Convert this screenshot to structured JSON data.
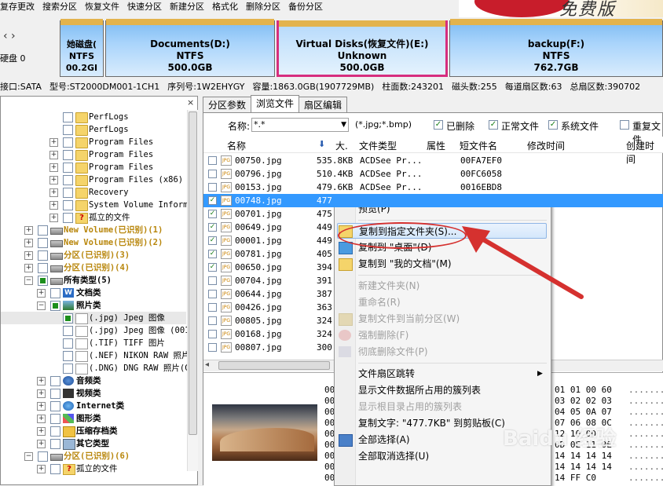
{
  "menubar": {
    "items": [
      "复存更改",
      "搜索分区",
      "恢复文件",
      "快速分区",
      "新建分区",
      "格式化",
      "删除分区",
      "备份分区"
    ]
  },
  "disk": {
    "label": "硬盘 0",
    "partitions": [
      {
        "name": "她磁盘(",
        "fs": "NTFS",
        "size": "00.2GI"
      },
      {
        "name": "Documents(D:)",
        "fs": "NTFS",
        "size": "500.0GB"
      },
      {
        "name": "Virtual Disks(恢复文件)(E:)",
        "fs": "Unknown",
        "size": "500.0GB"
      },
      {
        "name": "backup(F:)",
        "fs": "NTFS",
        "size": "762.7GB"
      }
    ]
  },
  "info_bar": [
    "接口:SATA",
    "型号:ST2000DM001-1CH1",
    "序列号:1W2EHYGY",
    "容量:1863.0GB(1907729MB)",
    "柱面数:243201",
    "磁头数:255",
    "每道扇区数:63",
    "总扇区数:390702"
  ],
  "tree": {
    "close": "×",
    "rows": [
      {
        "label": "PerfLogs",
        "indent": 4,
        "type": "folder",
        "expand": ""
      },
      {
        "label": "PerfLogs",
        "indent": 4,
        "type": "folder",
        "expand": ""
      },
      {
        "label": "Program Files",
        "indent": 4,
        "type": "folder",
        "expand": "+"
      },
      {
        "label": "Program Files",
        "indent": 4,
        "type": "folder",
        "expand": "+"
      },
      {
        "label": "Program Files",
        "indent": 4,
        "type": "folder",
        "expand": "+"
      },
      {
        "label": "Program Files (x86)",
        "indent": 4,
        "type": "folder",
        "expand": "+"
      },
      {
        "label": "Recovery",
        "indent": 4,
        "type": "folder",
        "expand": "+"
      },
      {
        "label": "System Volume Information",
        "indent": 4,
        "type": "folder",
        "expand": "+"
      },
      {
        "label": "孤立的文件",
        "indent": 4,
        "type": "q",
        "expand": "+"
      },
      {
        "label": "New Volume(已识别)(1)",
        "indent": 2,
        "type": "drive",
        "expand": "+",
        "style": "vol"
      },
      {
        "label": "New Volume(已识别)(2)",
        "indent": 2,
        "type": "drive",
        "expand": "+",
        "style": "vol"
      },
      {
        "label": "分区(已识别)(3)",
        "indent": 2,
        "type": "drive",
        "expand": "+",
        "style": "vol"
      },
      {
        "label": "分区(已识别)(4)",
        "indent": 2,
        "type": "drive",
        "expand": "+",
        "style": "vol"
      },
      {
        "label": "所有类型(5)",
        "indent": 2,
        "type": "drive",
        "expand": "−",
        "style": "bold",
        "partial": true
      },
      {
        "label": "文档类",
        "indent": 3,
        "type": "doc",
        "expand": "+",
        "style": "bold"
      },
      {
        "label": "照片类",
        "indent": 3,
        "type": "photo",
        "expand": "−",
        "style": "bold",
        "partial": true
      },
      {
        "label": "(.jpg) Jpeg 图像",
        "indent": 4,
        "type": "jpgi",
        "expand": "",
        "partial": true,
        "selected": true
      },
      {
        "label": "(.jpg) Jpeg 图像 (001)",
        "indent": 4,
        "type": "jpgi",
        "expand": ""
      },
      {
        "label": "(.TIF) TIFF 图片",
        "indent": 4,
        "type": "jpgi",
        "expand": ""
      },
      {
        "label": "(.NEF) NIKON RAW 照片",
        "indent": 4,
        "type": "jpgi",
        "expand": ""
      },
      {
        "label": "(.DNG) DNG RAW 照片(Ca",
        "indent": 4,
        "type": "jpgi",
        "expand": ""
      },
      {
        "label": "音频类",
        "indent": 3,
        "type": "music",
        "expand": "+",
        "style": "bold"
      },
      {
        "label": "视频类",
        "indent": 3,
        "type": "video",
        "expand": "+",
        "style": "bold"
      },
      {
        "label": "Internet类",
        "indent": 3,
        "type": "ie",
        "expand": "+",
        "style": "bold"
      },
      {
        "label": "图形类",
        "indent": 3,
        "type": "graph",
        "expand": "+",
        "style": "bold"
      },
      {
        "label": "压缩存档类",
        "indent": 3,
        "type": "zip",
        "expand": "+",
        "style": "bold"
      },
      {
        "label": "其它类型",
        "indent": 3,
        "type": "other",
        "expand": "+",
        "style": "bold"
      },
      {
        "label": "分区(已识别)(6)",
        "indent": 2,
        "type": "drive",
        "expand": "−",
        "style": "vol2"
      },
      {
        "label": "孤立的文件",
        "indent": 3,
        "type": "q",
        "expand": "+"
      }
    ]
  },
  "tabs": [
    "分区参数",
    "浏览文件",
    "扇区编辑"
  ],
  "filter": {
    "name_label": "名称:",
    "name_value": "*.*",
    "hint": "(*.jpg;*.bmp)",
    "checks": [
      {
        "label": "已删除",
        "checked": true
      },
      {
        "label": "正常文件",
        "checked": true
      },
      {
        "label": "系统文件",
        "checked": true
      },
      {
        "label": "重复文件",
        "checked": false
      }
    ]
  },
  "columns": [
    "名称",
    "大.",
    "文件类型",
    "属性",
    "短文件名",
    "修改时间",
    "创建时间"
  ],
  "files": [
    {
      "name": "00750.jpg",
      "size": "535.8KB",
      "type": "ACDSee Pr...",
      "short": "00FA7EF0",
      "checked": false
    },
    {
      "name": "00796.jpg",
      "size": "510.4KB",
      "type": "ACDSee Pr...",
      "short": "00FC6058",
      "checked": false
    },
    {
      "name": "00153.jpg",
      "size": "479.6KB",
      "type": "ACDSee Pr...",
      "short": "0016EBD8",
      "checked": false
    },
    {
      "name": "00748.jpg",
      "size": "477",
      "type": "",
      "short": "",
      "checked": true,
      "selected": true
    },
    {
      "name": "00701.jpg",
      "size": "475",
      "type": "",
      "short": "",
      "checked": true
    },
    {
      "name": "00649.jpg",
      "size": "449",
      "type": "",
      "short": "",
      "checked": true
    },
    {
      "name": "00001.jpg",
      "size": "449",
      "type": "",
      "short": "",
      "checked": true
    },
    {
      "name": "00781.jpg",
      "size": "405",
      "type": "",
      "short": "",
      "checked": true
    },
    {
      "name": "00650.jpg",
      "size": "394",
      "type": "",
      "short": "",
      "checked": true
    },
    {
      "name": "00704.jpg",
      "size": "391",
      "type": "",
      "short": "",
      "checked": false
    },
    {
      "name": "00644.jpg",
      "size": "387",
      "type": "",
      "short": "",
      "checked": false
    },
    {
      "name": "00426.jpg",
      "size": "363",
      "type": "",
      "short": "",
      "checked": false
    },
    {
      "name": "00805.jpg",
      "size": "324",
      "type": "",
      "short": "",
      "checked": false
    },
    {
      "name": "00168.jpg",
      "size": "324",
      "type": "",
      "short": "",
      "checked": false
    },
    {
      "name": "00807.jpg",
      "size": "300",
      "type": "",
      "short": "",
      "checked": false
    }
  ],
  "hex": {
    "left": [
      "00",
      "00",
      "00",
      "00",
      "00",
      "00",
      "00",
      "00",
      "00"
    ],
    "right": [
      "01 01 00 60",
      "03 02 02 03",
      "04 05 0A 07",
      "07 06 08 0C",
      "12 10 0D",
      "0D 0E 11 0E",
      "14 14 14 14",
      "14 14 14 14",
      "14 FF C0"
    ],
    "ascii": [
      ".......`",
      "........",
      "........",
      "........",
      "........",
      "........",
      "........",
      "........",
      "........"
    ]
  },
  "context_menu": {
    "items": [
      {
        "label": "预览(P)",
        "enabled": true
      },
      {
        "sep": true
      },
      {
        "label": "复制到指定文件夹(S)...",
        "enabled": true,
        "highlight": true,
        "icon": "copy-folder"
      },
      {
        "label": "复制到 \"桌面\"(D)",
        "enabled": true,
        "icon": "desktop"
      },
      {
        "label": "复制到 \"我的文档\"(M)",
        "enabled": true,
        "icon": "folder"
      },
      {
        "sep": true
      },
      {
        "label": "新建文件夹(N)",
        "enabled": false
      },
      {
        "label": "重命名(R)",
        "enabled": false
      },
      {
        "label": "复制文件到当前分区(W)",
        "enabled": false,
        "icon": "copy-part"
      },
      {
        "label": "强制删除(F)",
        "enabled": false,
        "icon": "del"
      },
      {
        "label": "彻底删除文件(P)",
        "enabled": false,
        "icon": "del2"
      },
      {
        "sep": true
      },
      {
        "label": "文件扇区跳转",
        "enabled": true,
        "submenu": true
      },
      {
        "label": "显示文件数据所占用的簇列表",
        "enabled": true
      },
      {
        "label": "显示根目录占用的簇列表",
        "enabled": false
      },
      {
        "label": "复制文字: \"477.7KB\" 到剪贴板(C)",
        "enabled": true
      },
      {
        "label": "全部选择(A)",
        "enabled": true,
        "icon": "check"
      },
      {
        "label": "全部取消选择(U)",
        "enabled": true
      }
    ]
  },
  "watermark": "Baidu 经验",
  "colors": {
    "accent": "#3399ff",
    "annotation": "#d5312f",
    "partition_sel": "#d62e7e"
  }
}
